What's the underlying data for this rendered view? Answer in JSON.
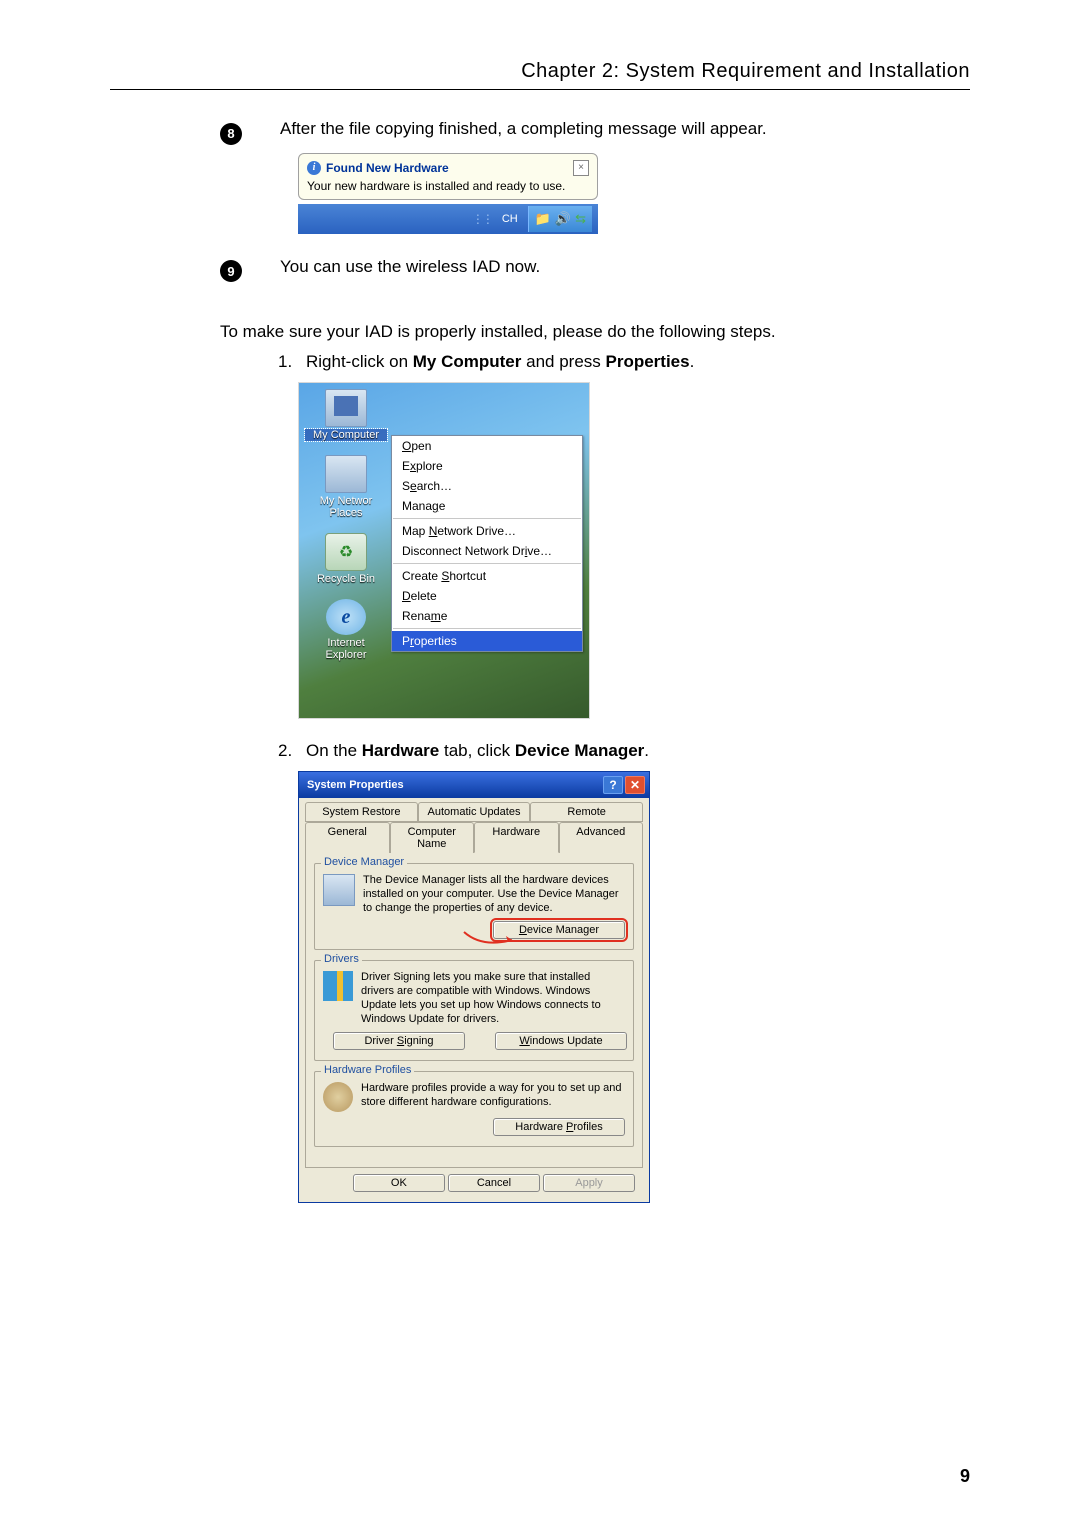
{
  "header": "Chapter 2: System Requirement and Installation",
  "page_number": "9",
  "steps": {
    "s8": {
      "num": "8",
      "text": "After the file copying finished, a completing message will appear."
    },
    "s9": {
      "num": "9",
      "text": "You can use the wireless IAD now."
    }
  },
  "balloon": {
    "title": "Found New Hardware",
    "message": "Your new hardware is installed and ready to use.",
    "tray_lang": "CH",
    "close": "×"
  },
  "verify_intro": "To make sure your IAD is properly installed, please do the following steps.",
  "verify_steps": {
    "v1a": "Right-click on ",
    "v1b": "My Computer",
    "v1c": " and press ",
    "v1d": "Properties",
    "v1e": ".",
    "v2a": "On the ",
    "v2b": "Hardware",
    "v2c": " tab, click ",
    "v2d": "Device Manager",
    "v2e": "."
  },
  "desktop": {
    "icons": {
      "mycomputer": "My Computer",
      "netplaces": "My Networ\nPlaces",
      "recycle": "Recycle Bin",
      "ie": "Internet\nExplorer"
    },
    "menu": {
      "open": "Open",
      "explore": "Explore",
      "search": "Search…",
      "manage": "Manage",
      "mapdrive": "Map Network Drive…",
      "disconnect": "Disconnect Network Drive…",
      "shortcut": "Create Shortcut",
      "delete": "Delete",
      "rename": "Rename",
      "properties": "Properties"
    }
  },
  "dialog": {
    "title": "System Properties",
    "tabs": {
      "restore": "System Restore",
      "updates": "Automatic Updates",
      "remote": "Remote",
      "general": "General",
      "compname": "Computer Name",
      "hardware": "Hardware",
      "advanced": "Advanced"
    },
    "devmgr": {
      "legend": "Device Manager",
      "text": "The Device Manager lists all the hardware devices installed on your computer. Use the Device Manager to change the properties of any device.",
      "button": "Device Manager"
    },
    "drivers": {
      "legend": "Drivers",
      "text": "Driver Signing lets you make sure that installed drivers are compatible with Windows. Windows Update lets you set up how Windows connects to Windows Update for drivers.",
      "signing": "Driver Signing",
      "update": "Windows Update"
    },
    "profiles": {
      "legend": "Hardware Profiles",
      "text": "Hardware profiles provide a way for you to set up and store different hardware configurations.",
      "button": "Hardware Profiles"
    },
    "ok": "OK",
    "cancel": "Cancel",
    "apply": "Apply"
  }
}
